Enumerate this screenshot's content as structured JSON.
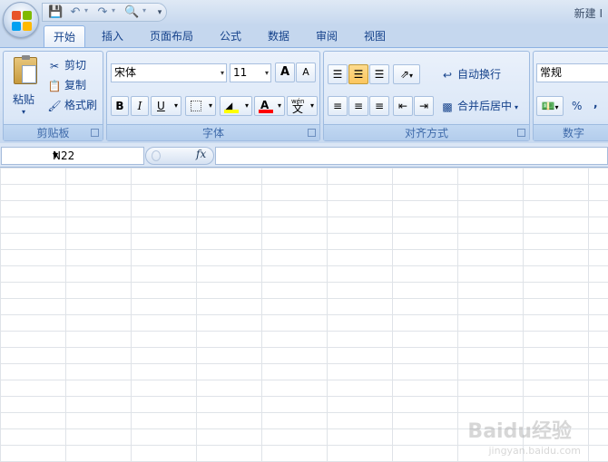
{
  "title_bar": {
    "text": "新建 I"
  },
  "quick_access": {
    "icons": [
      "save-icon",
      "undo-icon",
      "redo-icon",
      "print-preview-icon",
      "customize-icon"
    ]
  },
  "tabs": [
    {
      "label": "开始",
      "active": true
    },
    {
      "label": "插入"
    },
    {
      "label": "页面布局"
    },
    {
      "label": "公式"
    },
    {
      "label": "数据"
    },
    {
      "label": "审阅"
    },
    {
      "label": "视图"
    }
  ],
  "clipboard": {
    "label": "剪贴板",
    "paste": "粘贴",
    "cut": "剪切",
    "copy": "复制",
    "format_painter": "格式刷"
  },
  "font": {
    "label": "字体",
    "font_name": "宋体",
    "font_size": "11",
    "grow_font": "A",
    "shrink_font": "A",
    "bold": "B",
    "italic": "I",
    "underline": "U",
    "font_color_glyph": "A",
    "phonetic_glyph": "文",
    "phonetic_top": "wén",
    "fill_color": "#ffff00",
    "text_color": "#ff0000"
  },
  "alignment": {
    "label": "对齐方式",
    "wrap_text": "自动换行",
    "merge_center": "合并后居中"
  },
  "number": {
    "label": "数字",
    "format": "常规",
    "percent": "%",
    "comma": ","
  },
  "formula_bar": {
    "name_box": "N22",
    "fx": "fx",
    "formula": ""
  },
  "watermark": {
    "text": "Baidu经验",
    "sub": "jingyan.baidu.com"
  }
}
